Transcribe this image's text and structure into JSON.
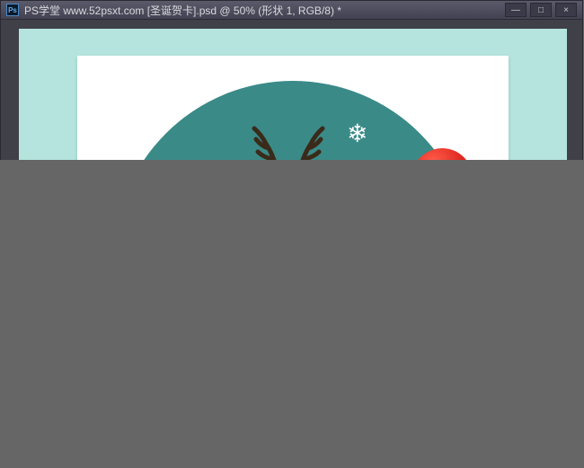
{
  "app": {
    "icon_text": "Ps",
    "title": "PS学堂  www.52psxt.com [圣诞贺卡].psd @ 50% (形状 1,  RGB/8) *"
  },
  "controls": {
    "minimize": "—",
    "maximize": "□",
    "close": "×"
  },
  "artwork": {
    "snowflake_glyph": "❄"
  }
}
